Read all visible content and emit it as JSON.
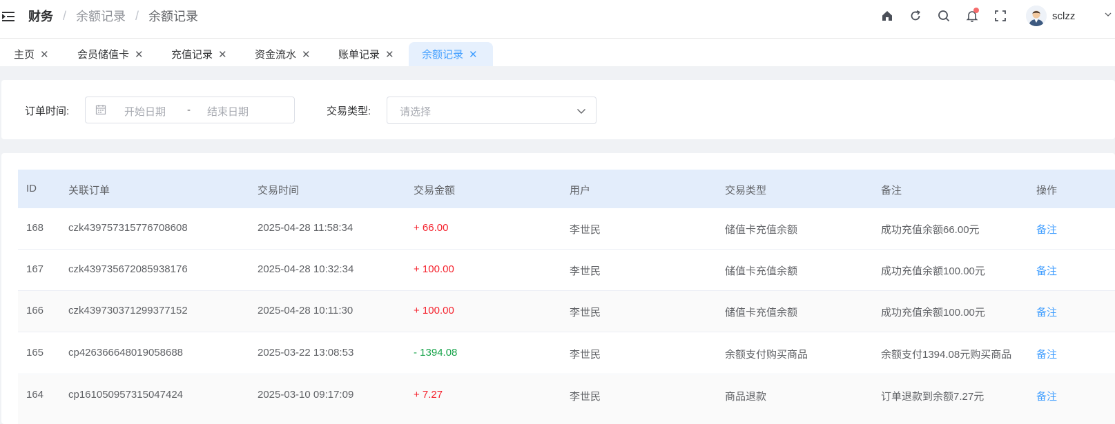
{
  "header": {
    "breadcrumb": [
      "财务",
      "余额记录",
      "余额记录"
    ],
    "username": "sclzz",
    "icons": [
      "home-icon",
      "refresh-icon",
      "search-icon",
      "bell-icon",
      "fullscreen-icon",
      "user-avatar"
    ]
  },
  "tags": [
    {
      "label": "主页",
      "active": false
    },
    {
      "label": "会员储值卡",
      "active": false
    },
    {
      "label": "充值记录",
      "active": false
    },
    {
      "label": "资金流水",
      "active": false
    },
    {
      "label": "账单记录",
      "active": false
    },
    {
      "label": "余额记录",
      "active": true
    }
  ],
  "filter": {
    "order_time_label": "订单时间:",
    "start_placeholder": "开始日期",
    "range_separator": "-",
    "end_placeholder": "结束日期",
    "type_label": "交易类型:",
    "type_placeholder": "请选择"
  },
  "table": {
    "columns": [
      "ID",
      "关联订单",
      "交易时间",
      "交易金额",
      "用户",
      "交易类型",
      "备注",
      "操作"
    ],
    "rows": [
      {
        "id": "168",
        "order": "czk439757315776708608",
        "time": "2025-04-28 11:58:34",
        "amount": "+ 66.00",
        "sign": "pos",
        "user": "李世民",
        "type": "储值卡充值余额",
        "note": "成功充值余额66.00元",
        "action": "备注"
      },
      {
        "id": "167",
        "order": "czk439735672085938176",
        "time": "2025-04-28 10:32:34",
        "amount": "+ 100.00",
        "sign": "pos",
        "user": "李世民",
        "type": "储值卡充值余额",
        "note": "成功充值余额100.00元",
        "action": "备注"
      },
      {
        "id": "166",
        "order": "czk439730371299377152",
        "time": "2025-04-28 10:11:30",
        "amount": "+ 100.00",
        "sign": "pos",
        "user": "李世民",
        "type": "储值卡充值余额",
        "note": "成功充值余额100.00元",
        "action": "备注"
      },
      {
        "id": "165",
        "order": "cp426366648019058688",
        "time": "2025-03-22 13:08:53",
        "amount": "- 1394.08",
        "sign": "neg",
        "user": "李世民",
        "type": "余额支付购买商品",
        "note": "余额支付1394.08元购买商品",
        "action": "备注"
      },
      {
        "id": "164",
        "order": "cp161050957315047424",
        "time": "2025-03-10 09:17:09",
        "amount": "+ 7.27",
        "sign": "pos",
        "user": "李世民",
        "type": "商品退款",
        "note": "订单退款到余额7.27元",
        "action": "备注"
      }
    ]
  },
  "colors": {
    "accent": "#409eff",
    "positive_amount": "#f5222d",
    "negative_amount": "#17a34a",
    "table_header_bg": "#e3edfb",
    "active_tag_bg": "#e6f0fd",
    "notification_dot": "#f56c6c"
  }
}
